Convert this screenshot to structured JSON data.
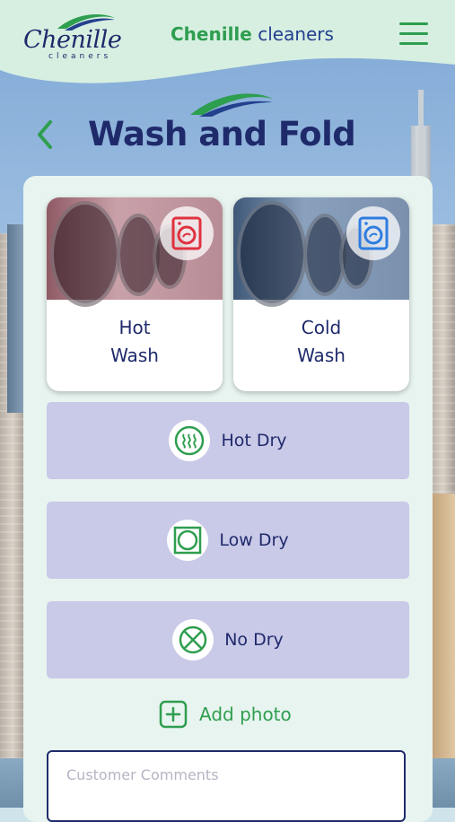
{
  "header": {
    "logo_text": "Chenille",
    "logo_subtext": "cleaners",
    "app_title_brand": "Chenille",
    "app_title_rest": " cleaners",
    "menu_icon": "hamburger-menu-icon"
  },
  "page": {
    "title": "Wash and Fold",
    "back_icon": "chevron-left-icon"
  },
  "wash_options": [
    {
      "line1": "Hot",
      "line2": "Wash",
      "icon": "washing-machine-icon",
      "icon_color": "#e0313f"
    },
    {
      "line1": "Cold",
      "line2": "Wash",
      "icon": "washing-machine-icon",
      "icon_color": "#2f7de0"
    }
  ],
  "dry_options": [
    {
      "label": "Hot Dry",
      "icon": "heat-waves-icon"
    },
    {
      "label": "Low Dry",
      "icon": "tumble-dry-icon"
    },
    {
      "label": "No Dry",
      "icon": "do-not-tumble-dry-icon"
    }
  ],
  "add_photo": {
    "label": "Add photo",
    "icon": "plus-square-icon"
  },
  "comments": {
    "placeholder": "Customer Comments",
    "value": ""
  },
  "colors": {
    "brand_green": "#2e9e4f",
    "brand_navy": "#1f2a6b",
    "option_bg": "#c9c9e8",
    "panel_bg": "#e8f4ef"
  }
}
